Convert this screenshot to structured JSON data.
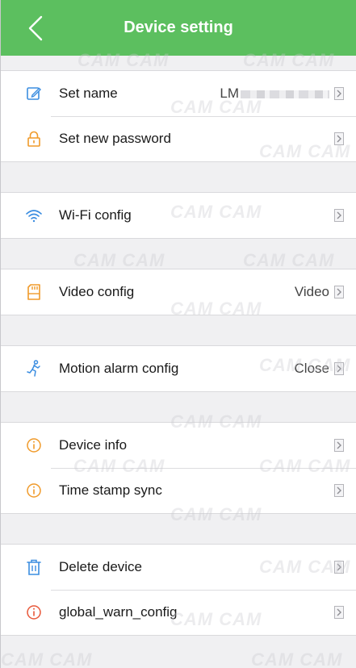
{
  "header": {
    "title": "Device setting",
    "color": "#5cbf5f"
  },
  "rows": {
    "set_name": {
      "label": "Set name",
      "value": "LM",
      "icon": "edit-icon"
    },
    "set_password": {
      "label": "Set new password",
      "icon": "lock-icon"
    },
    "wifi": {
      "label": "Wi-Fi config",
      "icon": "wifi-icon"
    },
    "video": {
      "label": "Video config",
      "value": "Video",
      "icon": "sd-card-icon"
    },
    "motion": {
      "label": "Motion alarm config",
      "value": "Close",
      "icon": "running-person-icon"
    },
    "device_info": {
      "label": "Device info",
      "icon": "info-icon"
    },
    "time_sync": {
      "label": "Time stamp sync",
      "icon": "info-icon"
    },
    "delete": {
      "label": "Delete device",
      "icon": "trash-icon"
    },
    "warn": {
      "label": "global_warn_config",
      "icon": "info-icon"
    }
  },
  "watermark_text": "CAM CAM",
  "colors": {
    "icon_blue": "#3b8de0",
    "icon_orange": "#f09a2a",
    "icon_red": "#e8583a"
  }
}
